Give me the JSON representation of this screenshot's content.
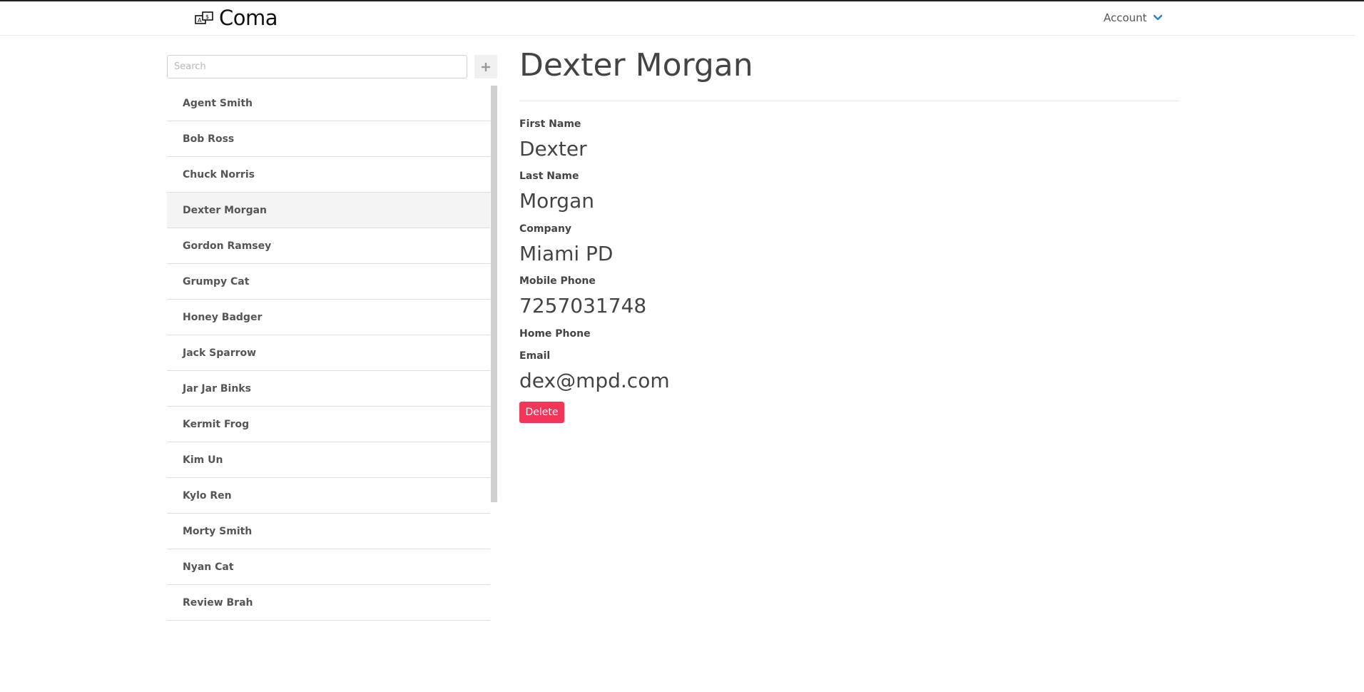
{
  "header": {
    "brand": "Coma",
    "account_label": "Account"
  },
  "sidebar": {
    "search_placeholder": "Search",
    "add_label": "+",
    "contacts": [
      "Agent Smith",
      "Bob Ross",
      "Chuck Norris",
      "Dexter Morgan",
      "Gordon Ramsey",
      "Grumpy Cat",
      "Honey Badger",
      "Jack Sparrow",
      "Jar Jar Binks",
      "Kermit Frog",
      "Kim Un",
      "Kylo Ren",
      "Morty Smith",
      "Nyan Cat",
      "Review Brah"
    ],
    "selected": "Dexter Morgan"
  },
  "detail": {
    "title": "Dexter Morgan",
    "fields": {
      "first_name": {
        "label": "First Name",
        "value": "Dexter"
      },
      "last_name": {
        "label": "Last Name",
        "value": "Morgan"
      },
      "company": {
        "label": "Company",
        "value": "Miami PD"
      },
      "mobile_phone": {
        "label": "Mobile Phone",
        "value": "7257031748"
      },
      "home_phone": {
        "label": "Home Phone",
        "value": ""
      },
      "email": {
        "label": "Email",
        "value": "dex@mpd.com"
      }
    },
    "delete_label": "Delete"
  },
  "colors": {
    "accent_blue": "#2f7fd3",
    "delete_red": "#f2365a",
    "selected_bg": "#f4f4f4",
    "text": "#444444"
  }
}
